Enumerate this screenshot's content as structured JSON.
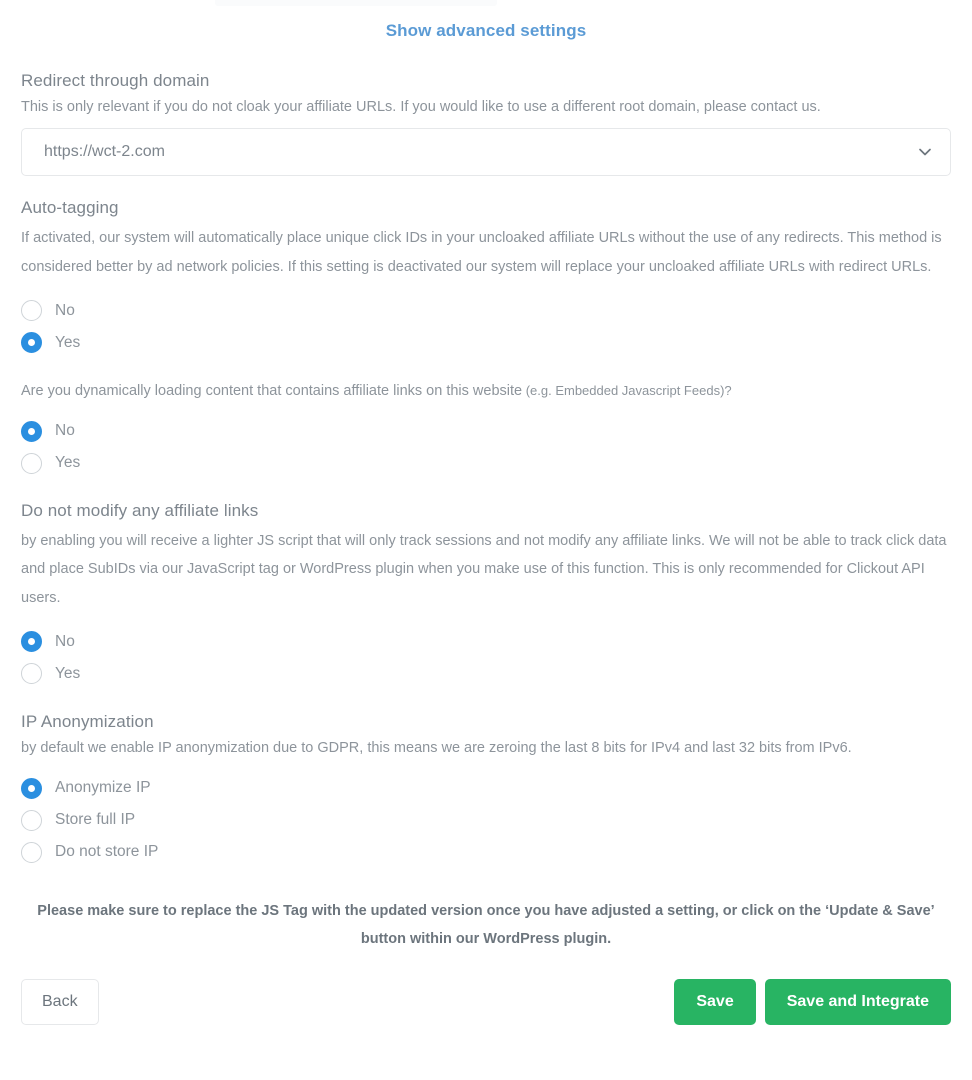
{
  "header": {
    "advanced_link": "Show advanced settings"
  },
  "sections": {
    "redirect": {
      "title": "Redirect through domain",
      "description": "This is only relevant if you do not cloak your affiliate URLs. If you would like to use a different root domain, please contact us.",
      "select": {
        "value": "https://wct-2.com",
        "icon": "chevron-down-icon"
      }
    },
    "auto_tagging": {
      "title": "Auto-tagging",
      "description": "If activated, our system will automatically place unique click IDs in your uncloaked affiliate URLs without the use of any redirects. This method is considered better by ad network policies. If this setting is deactivated our system will replace your uncloaked affiliate URLs with redirect URLs.",
      "options": [
        {
          "label": "No",
          "checked": false
        },
        {
          "label": "Yes",
          "checked": true
        }
      ]
    },
    "dynamic_content": {
      "title": "Are you dynamically loading content that contains affiliate links on this website",
      "title_small": " (e.g. Embedded Javascript Feeds)?",
      "options": [
        {
          "label": "No",
          "checked": true
        },
        {
          "label": "Yes",
          "checked": false
        }
      ]
    },
    "do_not_modify": {
      "title": "Do not modify any affiliate links",
      "description": "by enabling you will receive a lighter JS script that will only track sessions and not modify any affiliate links. We will not be able to track click data and place SubIDs via our JavaScript tag or WordPress plugin when you make use of this function. This is only recommended for Clickout API users.",
      "options": [
        {
          "label": "No",
          "checked": true
        },
        {
          "label": "Yes",
          "checked": false
        }
      ]
    },
    "ip_anonymization": {
      "title": "IP Anonymization",
      "description": "by default we enable IP anonymization due to GDPR, this means we are zeroing the last 8 bits for IPv4 and last 32 bits from IPv6.",
      "options": [
        {
          "label": "Anonymize IP",
          "checked": true
        },
        {
          "label": "Store full IP",
          "checked": false
        },
        {
          "label": "Do not store IP",
          "checked": false
        }
      ]
    }
  },
  "notice": "Please make sure to replace the JS Tag with the updated version once you have adjusted a setting, or click on the ‘Update & Save’ button within our WordPress plugin.",
  "footer": {
    "back_label": "Back",
    "save_label": "Save",
    "save_integrate_label": "Save and Integrate"
  },
  "colors": {
    "link_blue": "#5b9bd5",
    "radio_blue": "#2b8fe0",
    "button_green": "#28b463",
    "heading_grey": "#7d858d",
    "body_grey": "#8d949b"
  }
}
